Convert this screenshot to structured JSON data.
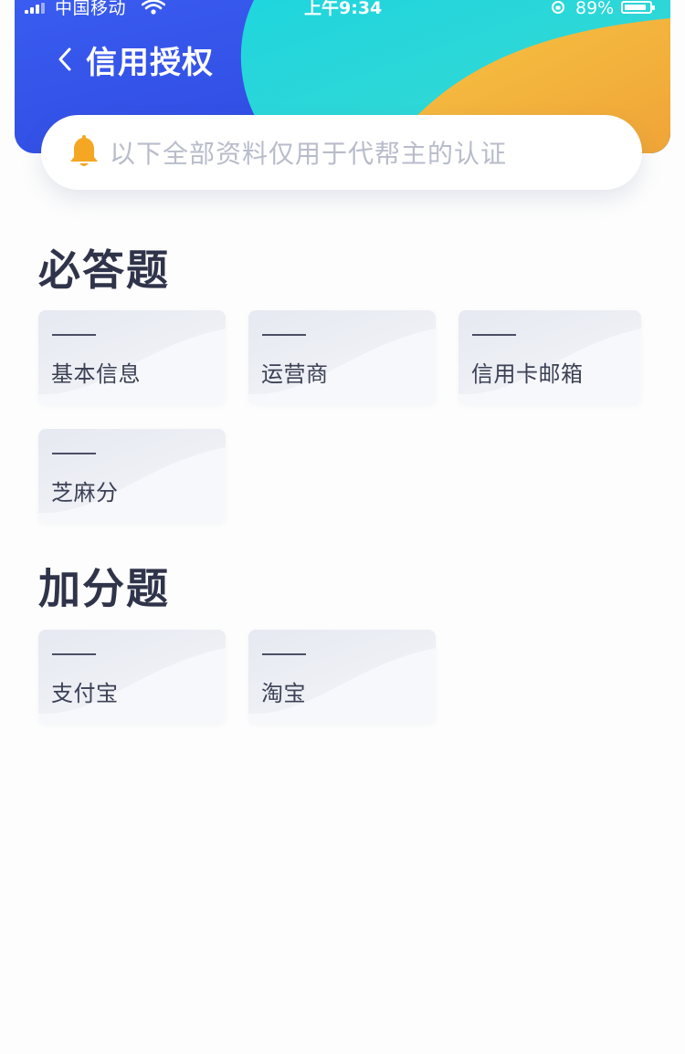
{
  "status_bar": {
    "carrier": "中国移动",
    "time": "上午9:34",
    "battery_percent": "89%",
    "battery_level": 0.89
  },
  "header": {
    "title": "信用授权",
    "colors": {
      "blue": "#2f4fe3",
      "cyan": "#23d4df",
      "orange": "#f2ae3a"
    }
  },
  "notice": {
    "text": "以下全部资料仅用于代帮主的认证",
    "bell_color": "#f5a623"
  },
  "sections": [
    {
      "title": "必答题",
      "items": [
        {
          "label": "基本信息"
        },
        {
          "label": "运营商"
        },
        {
          "label": "信用卡邮箱"
        },
        {
          "label": "芝麻分"
        }
      ]
    },
    {
      "title": "加分题",
      "items": [
        {
          "label": "支付宝"
        },
        {
          "label": "淘宝"
        }
      ]
    }
  ]
}
